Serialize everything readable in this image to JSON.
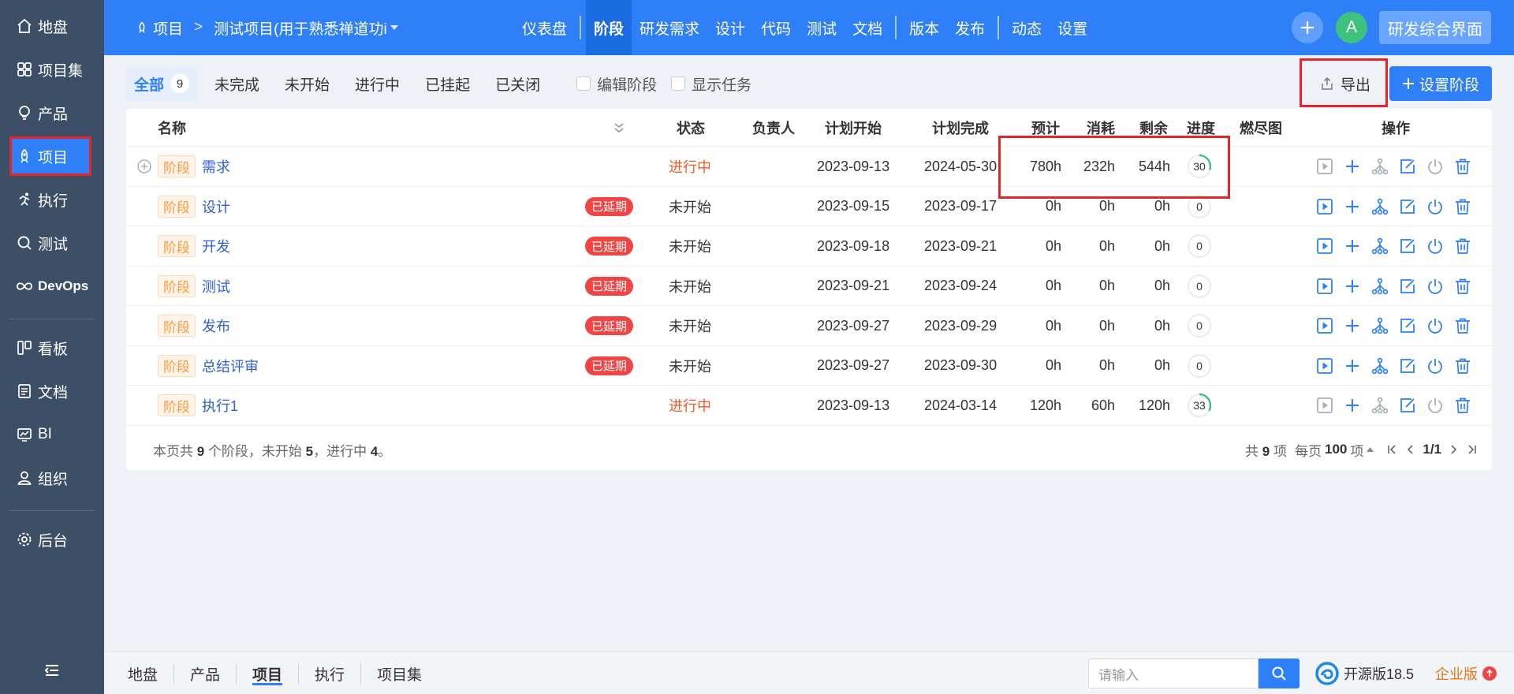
{
  "sidebar": {
    "items": [
      {
        "label": "地盘",
        "icon": "home-icon"
      },
      {
        "label": "项目集",
        "icon": "grid-icon"
      },
      {
        "label": "产品",
        "icon": "lightbulb-icon"
      },
      {
        "label": "项目",
        "icon": "rocket-icon"
      },
      {
        "label": "执行",
        "icon": "run-icon"
      },
      {
        "label": "测试",
        "icon": "magnifier-icon"
      },
      {
        "label": "DevOps",
        "icon": "infinity-icon"
      },
      {
        "label": "看板",
        "icon": "kanban-icon"
      },
      {
        "label": "文档",
        "icon": "document-icon"
      },
      {
        "label": "BI",
        "icon": "chart-icon"
      },
      {
        "label": "组织",
        "icon": "user-icon"
      },
      {
        "label": "后台",
        "icon": "gear-icon"
      }
    ],
    "active": "项目"
  },
  "header": {
    "project_label": "项目",
    "breadcrumb_sep": ">",
    "current_project": "测试项目(用于熟悉禅道功i",
    "nav": [
      "仪表盘",
      "阶段",
      "研发需求",
      "设计",
      "代码",
      "测试",
      "文档",
      "版本",
      "发布",
      "动态",
      "设置"
    ],
    "active_nav": "阶段",
    "avatar_letter": "A",
    "switch_label": "研发综合界面"
  },
  "filters": {
    "tabs": [
      {
        "label": "全部",
        "count": "9"
      },
      {
        "label": "未完成"
      },
      {
        "label": "未开始"
      },
      {
        "label": "进行中"
      },
      {
        "label": "已挂起"
      },
      {
        "label": "已关闭"
      }
    ],
    "edit_stage": "编辑阶段",
    "show_task": "显示任务",
    "export_label": "导出",
    "set_stage_label": "设置阶段"
  },
  "table": {
    "headers": {
      "name": "名称",
      "status": "状态",
      "owner": "负责人",
      "plan_start": "计划开始",
      "plan_end": "计划完成",
      "estimate": "预计",
      "consumed": "消耗",
      "left": "剩余",
      "progress": "进度",
      "burn": "燃尽图",
      "actions": "操作"
    },
    "stage_tag": "阶段",
    "delay_label": "已延期",
    "rows": [
      {
        "name": "需求",
        "delayed": false,
        "status": "进行中",
        "status_type": "doing",
        "start": "2023-09-13",
        "end": "2024-05-30",
        "estimate": "780h",
        "consumed": "232h",
        "left": "544h",
        "progress": "30",
        "progress_value": 30,
        "expandable": true,
        "actions_enabled": false
      },
      {
        "name": "设计",
        "delayed": true,
        "status": "未开始",
        "status_type": "wait",
        "start": "2023-09-15",
        "end": "2023-09-17",
        "estimate": "0h",
        "consumed": "0h",
        "left": "0h",
        "progress": "0",
        "progress_value": 0,
        "expandable": false,
        "actions_enabled": true
      },
      {
        "name": "开发",
        "delayed": true,
        "status": "未开始",
        "status_type": "wait",
        "start": "2023-09-18",
        "end": "2023-09-21",
        "estimate": "0h",
        "consumed": "0h",
        "left": "0h",
        "progress": "0",
        "progress_value": 0,
        "expandable": false,
        "actions_enabled": true
      },
      {
        "name": "测试",
        "delayed": true,
        "status": "未开始",
        "status_type": "wait",
        "start": "2023-09-21",
        "end": "2023-09-24",
        "estimate": "0h",
        "consumed": "0h",
        "left": "0h",
        "progress": "0",
        "progress_value": 0,
        "expandable": false,
        "actions_enabled": true
      },
      {
        "name": "发布",
        "delayed": true,
        "status": "未开始",
        "status_type": "wait",
        "start": "2023-09-27",
        "end": "2023-09-29",
        "estimate": "0h",
        "consumed": "0h",
        "left": "0h",
        "progress": "0",
        "progress_value": 0,
        "expandable": false,
        "actions_enabled": true
      },
      {
        "name": "总结评审",
        "delayed": true,
        "status": "未开始",
        "status_type": "wait",
        "start": "2023-09-27",
        "end": "2023-09-30",
        "estimate": "0h",
        "consumed": "0h",
        "left": "0h",
        "progress": "0",
        "progress_value": 0,
        "expandable": false,
        "actions_enabled": true
      },
      {
        "name": "执行1",
        "delayed": false,
        "status": "进行中",
        "status_type": "doing",
        "start": "2023-09-13",
        "end": "2024-03-14",
        "estimate": "120h",
        "consumed": "60h",
        "left": "120h",
        "progress": "33",
        "progress_value": 33,
        "expandable": false,
        "actions_enabled": false
      }
    ],
    "summary": {
      "prefix": "本页共 ",
      "total": "9",
      "mid1": " 个阶段，未开始 ",
      "wait": "5",
      "mid2": "，进行中 ",
      "doing": "4",
      "suffix": "。"
    },
    "pager": {
      "total_prefix": "共 ",
      "total": "9",
      "total_suffix": " 项",
      "per_page_prefix": "每页 ",
      "per_page": "100",
      "per_page_suffix": " 项",
      "page": "1/1"
    }
  },
  "footer": {
    "nav": [
      "地盘",
      "产品",
      "项目",
      "执行",
      "项目集"
    ],
    "active": "项目",
    "search_placeholder": "请输入",
    "version": "开源版18.5",
    "edition": "企业版"
  },
  "colors": {
    "primary": "#2e7ff8",
    "sidebar": "#3d4f66",
    "doing": "#f05a24",
    "delay": "#ef4545",
    "stage_tag": "#ff9a3c",
    "progress_arc": "#3ec37e",
    "highlight_box": "#e4262a"
  }
}
